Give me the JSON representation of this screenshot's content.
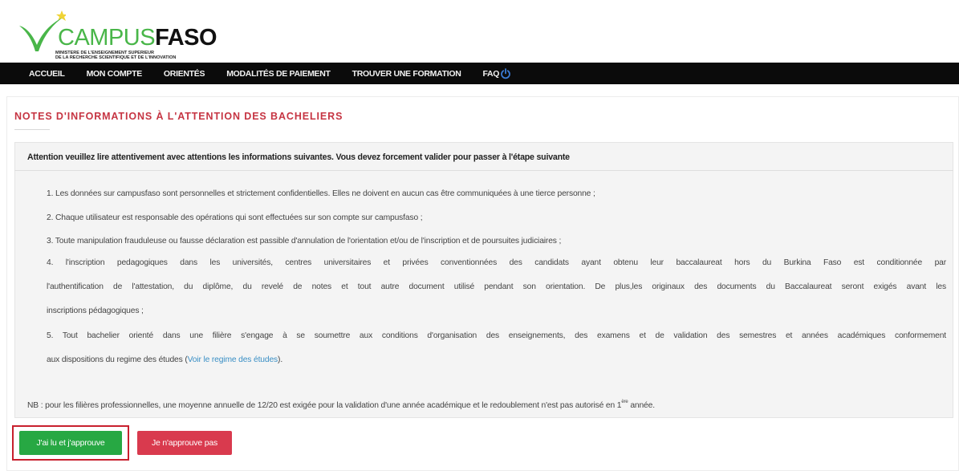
{
  "brand": {
    "name_part1": "CAMPUS",
    "name_part2": "FASO",
    "subtitle_line1": "MINISTERE DE L'ENSEIGNEMENT SUPERIEUR",
    "subtitle_line2": "DE LA RECHERCHE SCIENTIFIQUE ET DE L'INNOVATION",
    "colors": {
      "green": "#49b649",
      "star": "#f0d335",
      "dark": "#111111"
    }
  },
  "nav": {
    "items": [
      {
        "label": "ACCUEIL"
      },
      {
        "label": "MON COMPTE"
      },
      {
        "label": "ORIENTÉS"
      },
      {
        "label": "MODALITÉS DE PAIEMENT"
      },
      {
        "label": "TROUVER UNE FORMATION"
      },
      {
        "label": "FAQ"
      }
    ],
    "logout_icon": "power-icon",
    "accent_color": "#3a7bd5"
  },
  "main": {
    "title": "NOTES D'INFORMATIONS À L'ATTENTION DES BACHELIERS",
    "attention": "Attention veuillez lire attentivement avec attentions les informations suivantes. Vous devez forcement valider pour passer à l'étape suivante",
    "items": {
      "i1": "1. Les données sur campusfaso sont personnelles et strictement confidentielles. Elles ne doivent en aucun cas être communiquées à une tierce personne ;",
      "i2": "2. Chaque utilisateur est responsable des opérations qui sont effectuées sur son compte sur campusfaso ;",
      "i3": "3. Toute manipulation frauduleuse ou fausse déclaration est passible d'annulation de l'orientation et/ou de l'inscription et de poursuites judiciaires ;",
      "i4_line1": "4. l'inscription pedagogiques dans les universités, centres universitaires et privées conventionnées des candidats ayant obtenu leur baccalaureat hors du Burkina Faso est conditionnée par",
      "i4_line2": "l'authentification de l'attestation, du diplôme, du revelé de notes et tout autre document utilisé pendant son orientation. De plus,les originaux des documents du Baccalaureat seront exigés avant les",
      "i4_line3": "inscriptions pédagogiques ;",
      "i5_line1": "5. Tout bachelier orienté dans une filière s'engage à se soumettre aux conditions d'organisation des enseignements, des examens et de validation des semestres et années académiques conformement",
      "i5_line2_prefix": "aux dispositions du regime des études (",
      "i5_link": "Voir le regime des études",
      "i5_line2_suffix": ")."
    },
    "nb_prefix": "NB : pour les filières professionnelles, une moyenne annuelle de 12/20 est exigée pour la validation d'une année académique et le redoublement n'est pas autorisé en 1",
    "nb_sup": "ère",
    "nb_suffix": " année."
  },
  "buttons": {
    "approve": "J'ai lu et j'approuve",
    "reject": "Je n'approuve pas",
    "approve_color": "#27a843",
    "reject_color": "#d93a4e",
    "highlight_color": "#c8202e"
  }
}
